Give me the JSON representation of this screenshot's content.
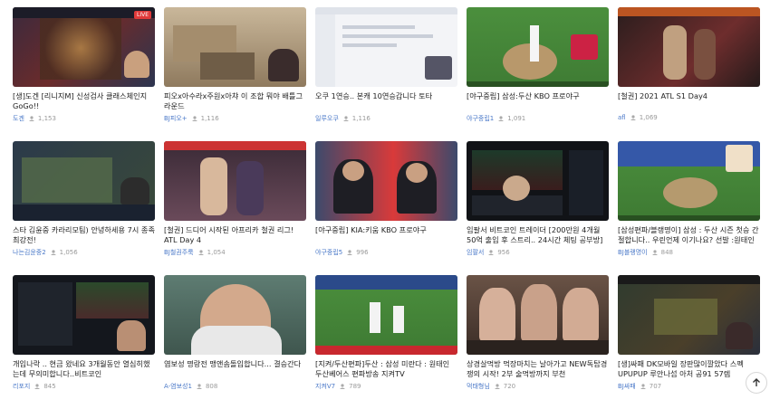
{
  "videos": [
    {
      "title": "[생]도겐 [리니지M] 신성검사 클래스체인지 GoGo!!",
      "channel": "도겐",
      "views": "1,153"
    },
    {
      "title": "피오x아수라x주원x아챠 이 조합 뭐야 배틀그라운드",
      "channel": "BJ피오+",
      "views": "1,116"
    },
    {
      "title": "오쿠 1연승.. 본캐 10연승갑니다 토타",
      "channel": "일루오쿠",
      "views": "1,116"
    },
    {
      "title": "[야구중립] 삼성:두산 KBO 프로야구",
      "channel": "야구중립1",
      "views": "1,091"
    },
    {
      "title": "[철권] 2021 ATL S1 Day4",
      "channel": "afl",
      "views": "1,069"
    },
    {
      "title": "스타 김윤중 카라리모팀) 안녕하세용 7시 종족최강전!",
      "channel": "나는김윤중2",
      "views": "1,056"
    },
    {
      "title": "[철권] 드디어 시작된 아프리카 철권 리그! ATL Day 4",
      "channel": "BJ철권주룩",
      "views": "1,054"
    },
    {
      "title": "[야구중립] KIA:키움 KBO 프로야구",
      "channel": "야구중립5",
      "views": "996"
    },
    {
      "title": "임팔서 비트코인 트레이더 [200만원 4개월 50억 출입 후 스트리.. 24시간 체팅 공부방]",
      "channel": "임팔서",
      "views": "956"
    },
    {
      "title": "[삼성편파/블랭명이] 삼성 : 두산 시즌 첫승 간절합니다.. 우린언제 이기나요? 선발 :원태인 vs ...",
      "channel": "BJ블랭명이",
      "views": "848"
    },
    {
      "title": "개입나락 .. 현금 왔네요 3개월동안 열심히했는데 무의미합니다..비트코인",
      "channel": "리포지",
      "views": "845"
    },
    {
      "title": "염보성 명랑전 맹앤솜돌입합니다... 결승간다",
      "channel": "A-염보성1",
      "views": "808"
    },
    {
      "title": "[지켜/두산편파]두산 : 삼성 미란다 : 원태인 두산베어스 편파방송 지켜TV",
      "channel": "지켜V7",
      "views": "789"
    },
    {
      "title": "상경살먹방 먹장마치는 날아가고 NEW독탑경쟁의 시작! 2부 술먹방까지 부천",
      "channel": "먹태형님",
      "views": "720"
    },
    {
      "title": "[생]싸패 DK모바일 장판많이깔았다 스펙UPUPUP 루안나섭 아처 공91 57렙",
      "channel": "BJ싸패",
      "views": "707"
    }
  ],
  "live_badge": "LIVE",
  "scroll_top_icon": "arrow-up-icon"
}
